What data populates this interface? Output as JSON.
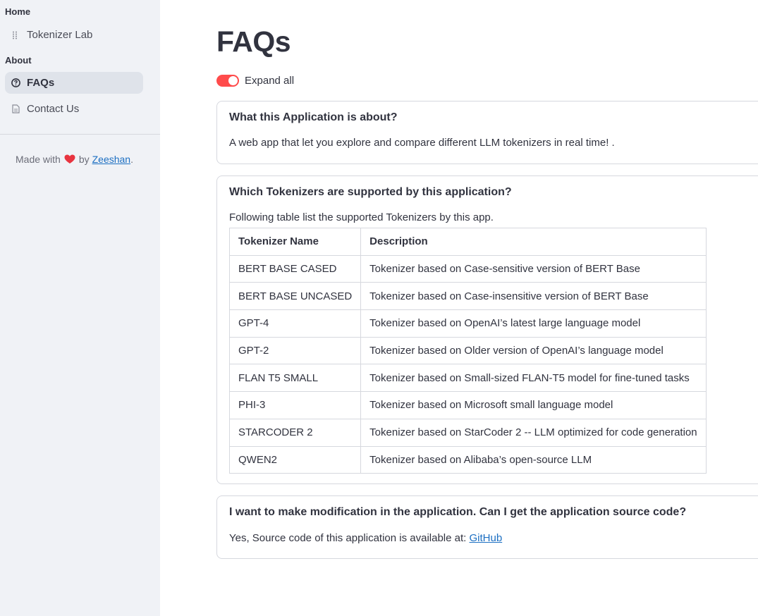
{
  "sidebar": {
    "section_home": "Home",
    "section_about": "About",
    "items": [
      {
        "label": "Tokenizer Lab",
        "icon": "grid-dots-icon",
        "active": false
      },
      {
        "label": "FAQs",
        "icon": "question-circle-icon",
        "active": true
      },
      {
        "label": "Contact Us",
        "icon": "document-icon",
        "active": false
      }
    ],
    "footer": {
      "prefix": "Made with",
      "icon": "heart-icon",
      "by": "by",
      "author_link": "Zeeshan",
      "suffix": "."
    }
  },
  "main": {
    "title": "FAQs",
    "expand_toggle": {
      "label": "Expand all",
      "on": true
    },
    "faqs": [
      {
        "question": "What this Application is about?",
        "answer": "A web app that let you explore and compare different LLM tokenizers in real time! ."
      },
      {
        "question": "Which Tokenizers are supported by this application?",
        "answer": "Following table list the supported Tokenizers by this app.",
        "table": {
          "headers": [
            "Tokenizer Name",
            "Description"
          ],
          "rows": [
            [
              "BERT BASE CASED",
              "Tokenizer based on Case-sensitive version of BERT Base"
            ],
            [
              "BERT BASE UNCASED",
              "Tokenizer based on Case-insensitive version of BERT Base"
            ],
            [
              "GPT-4",
              "Tokenizer based on OpenAI’s latest large language model"
            ],
            [
              "GPT-2",
              "Tokenizer based on Older version of OpenAI’s language model"
            ],
            [
              "FLAN T5 SMALL",
              "Tokenizer based on Small-sized FLAN-T5 model for fine-tuned tasks"
            ],
            [
              "PHI-3",
              "Tokenizer based on Microsoft small language model"
            ],
            [
              "STARCODER 2",
              "Tokenizer based on StarCoder 2 -- LLM optimized for code generation"
            ],
            [
              "QWEN2",
              "Tokenizer based on Alibaba’s open-source LLM"
            ]
          ]
        }
      },
      {
        "question": "I want to make modification in the application. Can I get the application source code?",
        "answer": "Yes, Source code of this application is available at:",
        "link": "GitHub"
      }
    ]
  },
  "colors": {
    "sidebar_bg": "#f0f2f6",
    "active_item_bg": "#dfe3ea",
    "toggle_on": "#ff4b4b",
    "link": "#1c6fc2",
    "text": "#31333f"
  }
}
